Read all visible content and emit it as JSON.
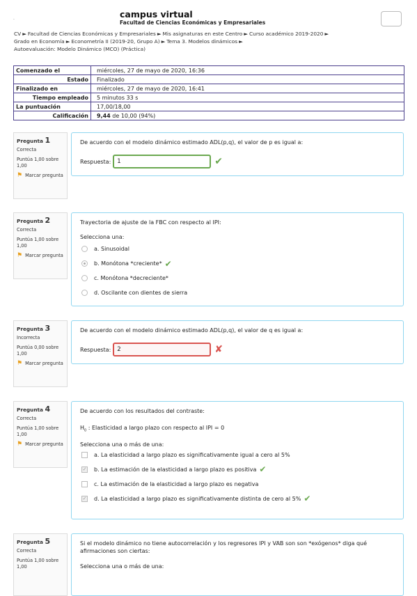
{
  "header": {
    "dot": ".",
    "site_title": "campus virtual",
    "site_subtitle": "Facultad de Ciencias Económicas y Empresariales",
    "breadcrumb": [
      "CV",
      "Facultad de Ciencias Económicas y Empresariales",
      "Mis asignaturas en este Centro",
      "Curso académico 2019-2020",
      "Grado en Economía",
      "Econometría II (2019-20, Grupo A)",
      "Tema 3. Modelos dinámicos",
      "Autoevaluación: Modelo Dinámico (MCO) (Práctica)"
    ]
  },
  "summary": [
    {
      "label": "Comenzado el",
      "value": "miércoles, 27 de mayo de 2020, 16:36",
      "align": "left"
    },
    {
      "label": "Estado",
      "value": "Finalizado",
      "align": "right"
    },
    {
      "label": "Finalizado en",
      "value": "miércoles, 27 de mayo de 2020, 16:41",
      "align": "left"
    },
    {
      "label": "Tiempo empleado",
      "value": "5 minutos 33 s",
      "align": "right"
    },
    {
      "label": "La puntuación",
      "value": "17,00/18,00",
      "align": "left"
    },
    {
      "label": "Calificación",
      "value_bold": "9,44",
      "value": " de 10,00 (94%)",
      "align": "right"
    }
  ],
  "flag_label": "Marcar pregunta",
  "questions": [
    {
      "label": "Pregunta",
      "num": "1",
      "state": "Correcta",
      "points": "Puntúa 1,00 sobre 1,00",
      "text": "De acuerdo con el modelo dinámico estimado ADL(p,q), el valor de p es igual a:",
      "answer_label": "Respuesta:",
      "answer": "1"
    },
    {
      "label": "Pregunta",
      "num": "2",
      "state": "Correcta",
      "points": "Puntúa 1,00 sobre 1,00",
      "text": "Trayectoria de ajuste de la FBC con respecto al IPI:",
      "prompt": "Selecciona una:",
      "options": [
        "a. Sinusoidal",
        "b. Monótona *creciente*",
        "c. Monótona *decreciente*",
        "d. Oscilante con dientes de sierra"
      ]
    },
    {
      "label": "Pregunta",
      "num": "3",
      "state": "Incorrecta",
      "points": "Puntúa 0,00 sobre 1,00",
      "text": "De acuerdo con el modelo dinámico estimado ADL(p,q), el valor de q es igual a:",
      "answer_label": "Respuesta:",
      "answer": "2"
    },
    {
      "label": "Pregunta",
      "num": "4",
      "state": "Correcta",
      "points": "Puntúa 1,00 sobre 1,00",
      "text": "De acuerdo con los resultados del contraste:",
      "hyp_h": "H",
      "hyp_sub": "0",
      "hyp_text": " : Elasticidad a largo plazo con respecto al IPI = 0",
      "prompt": "Selecciona una o más de una:",
      "options": [
        "a. La elasticidad a largo plazo es significativamente igual a cero al 5%",
        "b. La estimación de la elasticidad a largo plazo es positiva",
        "c. La estimación de la elasticidad a largo plazo es negativa",
        "d. La elasticidad a largo plazo es significativamente distinta de cero al 5%"
      ]
    },
    {
      "label": "Pregunta",
      "num": "5",
      "state": "Correcta",
      "points": "Puntúa 1,00 sobre 1,00",
      "text": "Si el modelo dinámico no tiene autocorrelación y los regresores IPI y VAB son son *exógenos* diga qué afirmaciones son ciertas:",
      "prompt": "Selecciona una o más de una:"
    }
  ]
}
